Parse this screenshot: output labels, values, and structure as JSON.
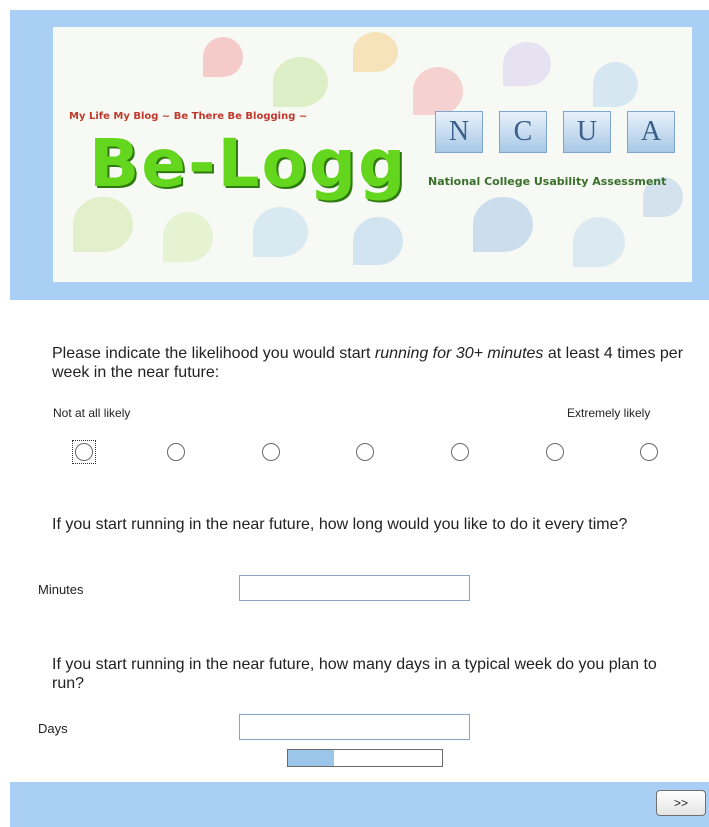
{
  "banner": {
    "tagline": "My Life My Blog ~ Be There Be Blogging ~",
    "title": "Be-Logg",
    "ncua_letters": [
      "N",
      "C",
      "U",
      "A"
    ],
    "ncua_subtitle": "National College Usability Assessment"
  },
  "question1": {
    "text_before": "Please indicate the likelihood you would start ",
    "text_emphasis": "running for 30+ minutes",
    "text_after": " at least 4 times per week in the near future:",
    "low_label": "Not at all likely",
    "high_label": "Extremely likely",
    "scale_points": 7,
    "selected": null
  },
  "question2": {
    "text": "If you start running in the near future, how long would you like to do it every time?",
    "field_label": "Minutes",
    "value": ""
  },
  "question3": {
    "text": "If you start running in the near future, how many days in a typical week do you plan to run?",
    "field_label": "Days",
    "value": ""
  },
  "progress": {
    "fraction": 0.3
  },
  "navigation": {
    "next_label": ">>"
  },
  "colors": {
    "band": "#a9cff4",
    "logo_green": "#63d61d",
    "progress_fill": "#9cc5ea"
  }
}
